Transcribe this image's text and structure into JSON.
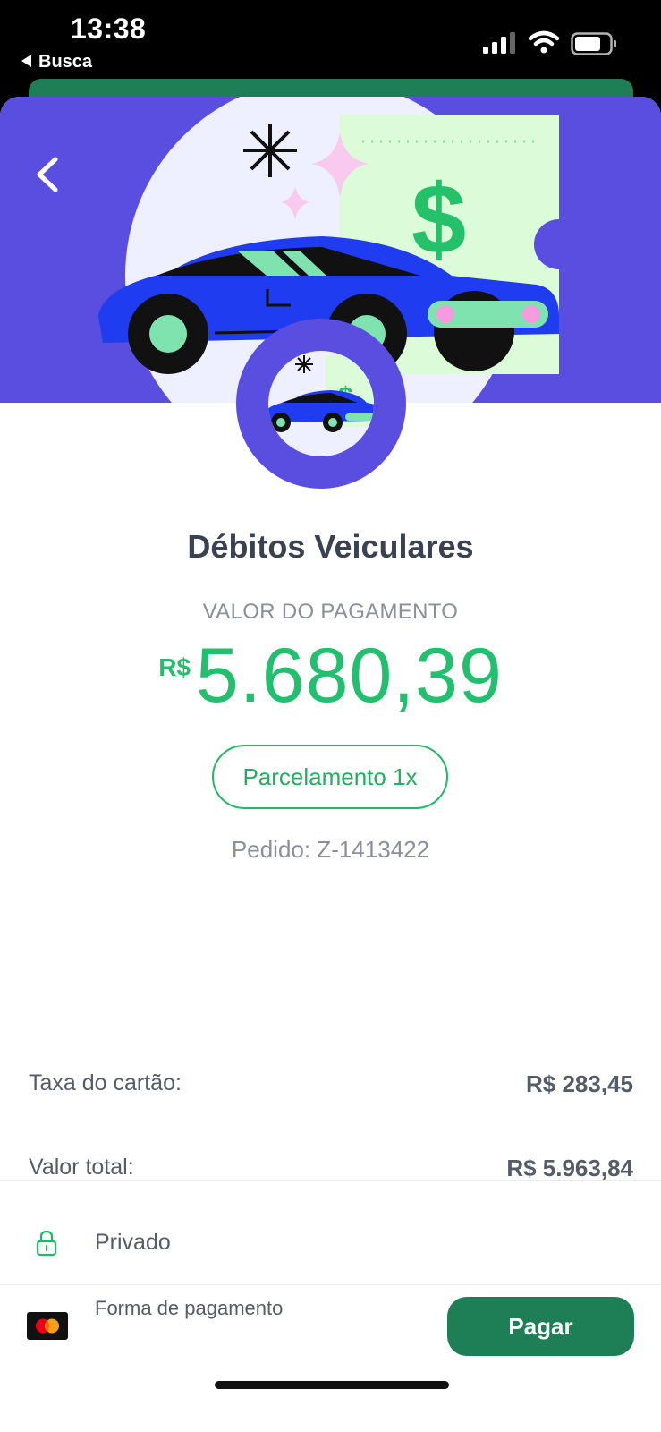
{
  "status_bar": {
    "time": "13:38",
    "back_app_label": "Busca"
  },
  "hero": {
    "illustration": "car-with-dollar-ticket",
    "back_icon": "chevron-left-icon"
  },
  "product": {
    "title": "Débitos Veiculares",
    "payment_label": "VALOR DO PAGAMENTO",
    "currency": "R$",
    "amount": "5.680,39",
    "installment_label": "Parcelamento 1x",
    "order_label": "Pedido: Z-1413422"
  },
  "summary": {
    "fee_label": "Taxa do cartão:",
    "fee_value": "R$ 283,45",
    "total_label": "Valor total:",
    "total_value": "R$ 5.963,84"
  },
  "privacy": {
    "icon": "lock-icon",
    "label": "Privado"
  },
  "payment": {
    "method_icon": "mastercard-icon",
    "method_label": "Forma de pagamento",
    "pay_button": "Pagar"
  },
  "colors": {
    "accent_green": "#22c06e",
    "dark_green": "#1e7f57",
    "hero_purple": "#5a4ee0",
    "text_dark": "#3a4150",
    "text_muted": "#8a8f99"
  }
}
